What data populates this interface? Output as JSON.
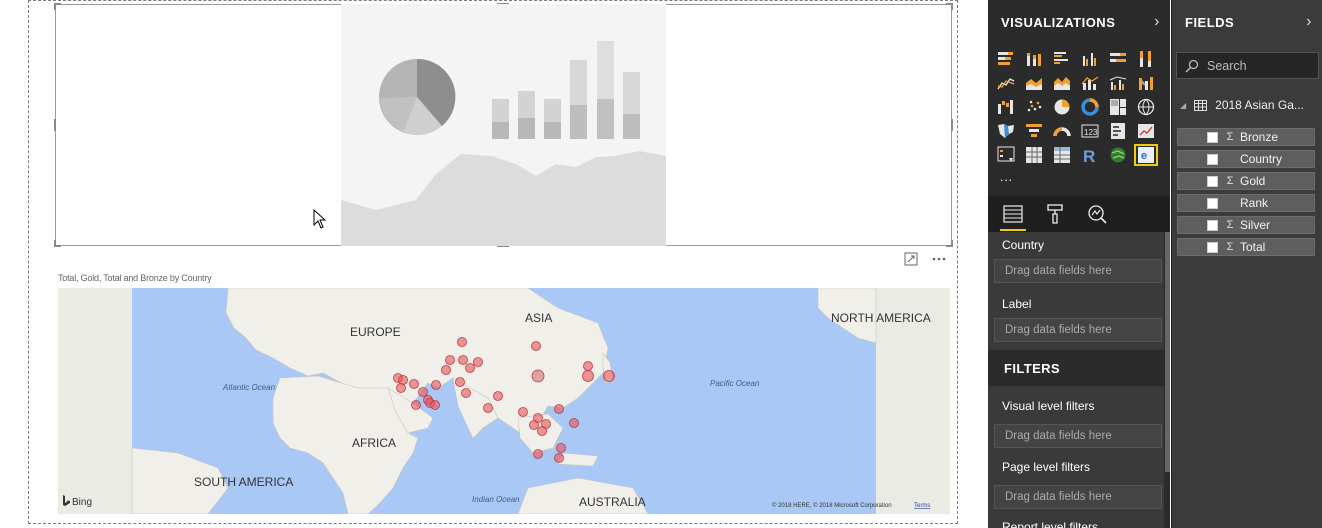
{
  "report": {
    "map_title": "Total, Gold, Total and Bronze by Country",
    "map_attribution": "© 2018 HERE, © 2018 Microsoft Corporation",
    "map_terms": "Terms",
    "bing_label": "Bing",
    "map_labels": {
      "europe": "EUROPE",
      "asia": "ASIA",
      "africa": "AFRICA",
      "north_america": "NORTH AMERICA",
      "south_america": "SOUTH AMERICA",
      "australia": "AUSTRALIA",
      "atlantic": "Atlantic Ocean",
      "pacific": "Pacific Ocean",
      "indian": "Indian Ocean"
    },
    "colors": {
      "bubble": "#e8545a",
      "water": "#a9c8f5",
      "land": "#f1efe9"
    }
  },
  "visualizations": {
    "title": "VISUALIZATIONS",
    "more": "...",
    "icons": [
      "stacked-bar-icon",
      "stacked-column-icon",
      "clustered-bar-icon",
      "clustered-column-icon",
      "100-bar-icon",
      "100-column-icon",
      "line-chart-icon",
      "area-chart-icon",
      "stacked-area-icon",
      "line-column-icon",
      "line-clustered-column-icon",
      "ribbon-chart-icon",
      "waterfall-icon",
      "scatter-icon",
      "pie-icon",
      "donut-icon",
      "treemap-icon",
      "map-icon",
      "filled-map-icon",
      "funnel-icon",
      "gauge-icon",
      "card-icon",
      "multi-row-card-icon",
      "kpi-icon",
      "slicer-icon",
      "table-icon",
      "matrix-icon",
      "r-visual-icon",
      "arcgis-icon",
      "custom-visual-icon"
    ],
    "wells": {
      "country_label": "Country",
      "country_placeholder": "Drag data fields here",
      "label_label": "Label",
      "label_placeholder": "Drag data fields here"
    },
    "filters": {
      "title": "FILTERS",
      "visual_level": "Visual level filters",
      "visual_placeholder": "Drag data fields here",
      "page_level": "Page level filters",
      "page_placeholder": "Drag data fields here",
      "report_level": "Report level filters"
    }
  },
  "fields": {
    "title": "FIELDS",
    "search_placeholder": "Search",
    "table_name": "2018 Asian Ga...",
    "items": [
      {
        "name": "Bronze",
        "sigma": "Σ"
      },
      {
        "name": "Country",
        "sigma": ""
      },
      {
        "name": "Gold",
        "sigma": "Σ"
      },
      {
        "name": "Rank",
        "sigma": ""
      },
      {
        "name": "Silver",
        "sigma": "Σ"
      },
      {
        "name": "Total",
        "sigma": "Σ"
      }
    ]
  }
}
